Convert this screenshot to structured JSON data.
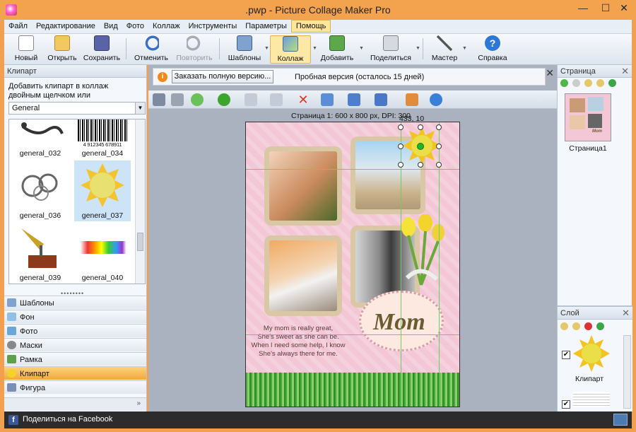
{
  "window": {
    "title": ".pwp - Picture Collage Maker Pro"
  },
  "menu": [
    "Файл",
    "Редактирование",
    "Вид",
    "Фото",
    "Коллаж",
    "Инструменты",
    "Параметры",
    "Помощь"
  ],
  "menu_active": "Помощь",
  "toolbar": {
    "new": "Новый",
    "open": "Открыть",
    "save": "Сохранить",
    "undo": "Отменить",
    "redo": "Повторить",
    "templates": "Шаблоны",
    "collage": "Коллаж",
    "add": "Добавить",
    "share": "Поделиться",
    "wizard": "Мастер",
    "help": "Справка"
  },
  "left": {
    "header": "Клипарт",
    "hint": "Добавить клипарт в коллаж двойным щелчком или перетаскиванием",
    "category": "General",
    "clips": [
      "general_032",
      "general_034",
      "general_036",
      "general_037",
      "general_039",
      "general_040"
    ],
    "barcode_number": "4 912345 678911",
    "nav": [
      "Шаблоны",
      "Фон",
      "Фото",
      "Маски",
      "Рамка",
      "Клипарт",
      "Фигура"
    ],
    "nav_active": "Клипарт",
    "more": "»"
  },
  "center": {
    "order_button": "Заказать полную версию...",
    "trial_text": "Пробная версия (осталось 15 дней)",
    "page_info": "Страница  1: 600 x 800 px, DPI: 300",
    "coords": "433, 10",
    "canvas_text": {
      "mom": "Mom",
      "poem": [
        "My mom is really great,",
        "She's sweet as she can be.",
        "When I need some help, I know",
        "She's always there for me."
      ]
    }
  },
  "right": {
    "page_header": "Страница",
    "page_label": "Страница1",
    "thumb_mom": "Mom",
    "layer_header": "Слой",
    "layer_label": "Клипарт"
  },
  "status": {
    "facebook": "Поделиться на Facebook"
  },
  "colors": {
    "title_bar": "#f3a24e",
    "accent": "#f2a93e",
    "canvas_bg": "#f3c7d6",
    "guide": "#62d262"
  }
}
